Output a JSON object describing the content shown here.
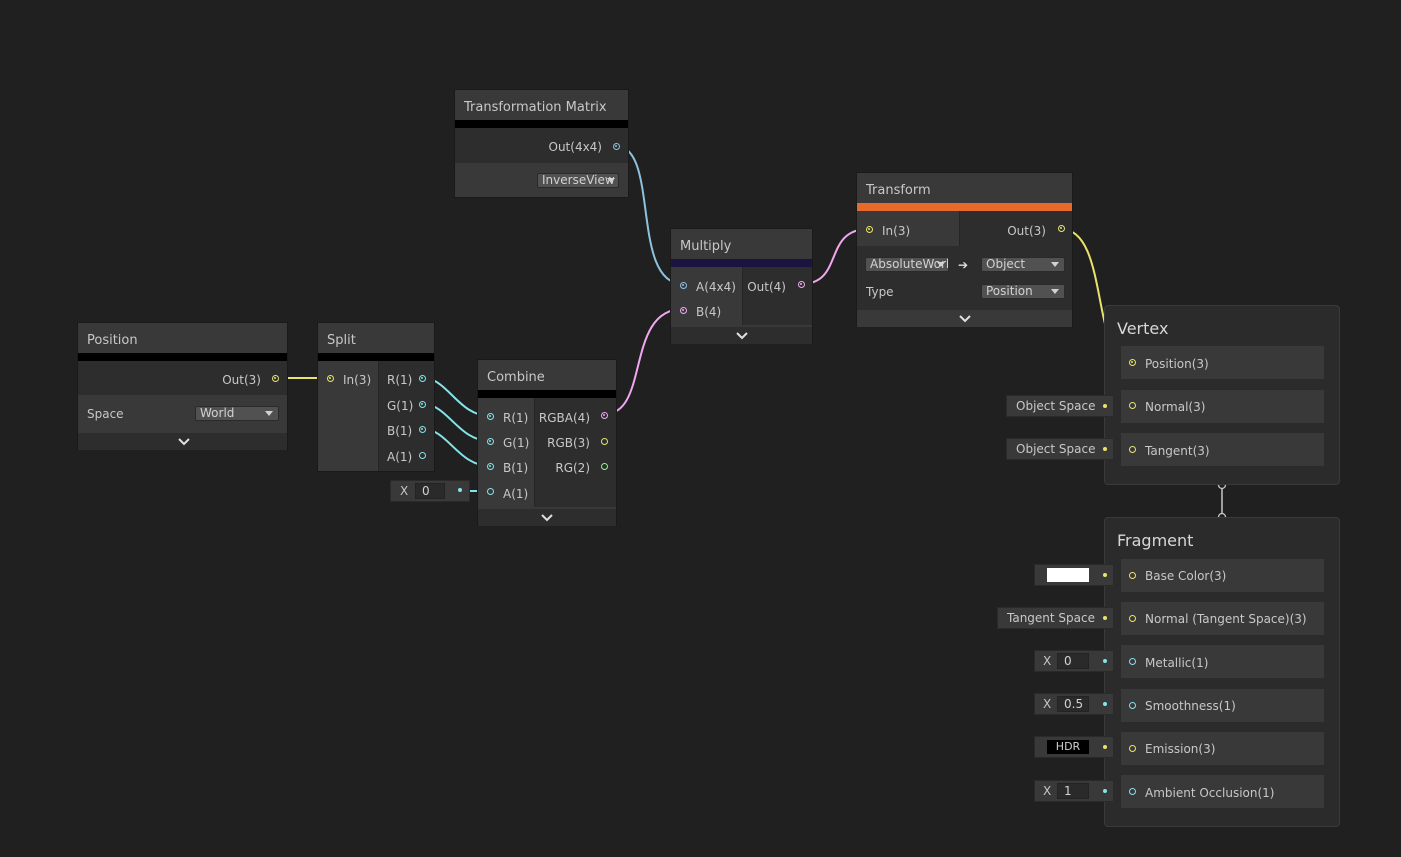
{
  "colors": {
    "background": "#202020",
    "node_body": "#393939",
    "node_section": "#2d2d2d",
    "vector3": "#e8e46b",
    "vector1": "#84e4e7",
    "vector4": "#f1a7f0",
    "vector2": "#9aef92",
    "matrix": "#8fc1df",
    "transform_accent": "#e8692a",
    "multiply_accent": "#1c1440"
  },
  "nodes": {
    "position": {
      "title": "Position",
      "out": "Out(3)",
      "space_label": "Space",
      "space_value": "World"
    },
    "split": {
      "title": "Split",
      "in": "In(3)",
      "outs": [
        "R(1)",
        "G(1)",
        "B(1)",
        "A(1)"
      ]
    },
    "combine": {
      "title": "Combine",
      "ins": [
        "R(1)",
        "G(1)",
        "B(1)",
        "A(1)"
      ],
      "outs": [
        "RGBA(4)",
        "RGB(3)",
        "RG(2)"
      ],
      "a_input": {
        "axis": "X",
        "value": "0"
      }
    },
    "matrix": {
      "title": "Transformation Matrix",
      "out": "Out(4x4)",
      "type_value": "InverseView"
    },
    "multiply": {
      "title": "Multiply",
      "in_a": "A(4x4)",
      "in_b": "B(4)",
      "out": "Out(4)"
    },
    "transform": {
      "title": "Transform",
      "in": "In(3)",
      "out": "Out(3)",
      "from_space": "AbsoluteWorld",
      "arrow": "➔",
      "to_space": "Object",
      "type_label": "Type",
      "type_value": "Position"
    }
  },
  "vertex": {
    "title": "Vertex",
    "slots": [
      "Position(3)",
      "Normal(3)",
      "Tangent(3)"
    ],
    "normal_input": "Object Space",
    "tangent_input": "Object Space"
  },
  "fragment": {
    "title": "Fragment",
    "slots": [
      "Base Color(3)",
      "Normal (Tangent Space)(3)",
      "Metallic(1)",
      "Smoothness(1)",
      "Emission(3)",
      "Ambient Occlusion(1)"
    ],
    "normal_input": "Tangent Space",
    "metallic": {
      "axis": "X",
      "value": "0"
    },
    "smoothness": {
      "axis": "X",
      "value": "0.5"
    },
    "emission_input": "HDR",
    "occlusion": {
      "axis": "X",
      "value": "1"
    }
  }
}
